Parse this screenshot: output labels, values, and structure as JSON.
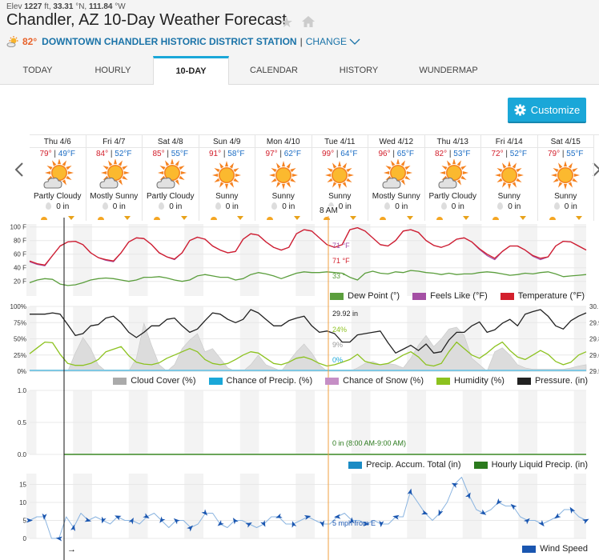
{
  "header": {
    "elev_label": "Elev",
    "elev_value": "1227",
    "elev_unit": "ft,",
    "lat": "33.31",
    "lat_unit": "°N,",
    "lon": "111.84",
    "lon_unit": "°W",
    "title": "Chandler, AZ 10-Day Weather Forecast",
    "current_temp": "82°",
    "station_name": "DOWNTOWN CHANDLER HISTORIC DISTRICT STATION",
    "separator": "|",
    "change_label": "CHANGE"
  },
  "tabs": [
    {
      "label": "TODAY",
      "active": false
    },
    {
      "label": "HOURLY",
      "active": false
    },
    {
      "label": "10-DAY",
      "active": true
    },
    {
      "label": "CALENDAR",
      "active": false
    },
    {
      "label": "HISTORY",
      "active": false
    },
    {
      "label": "WUNDERMAP",
      "active": false
    }
  ],
  "customize_label": "Customize",
  "icons": {
    "prev": "chevron-left-icon",
    "next": "chevron-right-icon",
    "settings": "gear-icon",
    "favorite": "star-icon",
    "home": "home-icon"
  },
  "days": [
    {
      "date": "Thu 4/6",
      "high": "79°",
      "low": "49°F",
      "condition": "Partly Cloudy",
      "icon": "partly-cloudy",
      "precip": "0 in"
    },
    {
      "date": "Fri 4/7",
      "high": "84°",
      "low": "52°F",
      "condition": "Mostly Sunny",
      "icon": "mostly-sunny",
      "precip": "0 in"
    },
    {
      "date": "Sat 4/8",
      "high": "85°",
      "low": "55°F",
      "condition": "Partly Cloudy",
      "icon": "partly-cloudy",
      "precip": "0 in"
    },
    {
      "date": "Sun 4/9",
      "high": "91°",
      "low": "58°F",
      "condition": "Sunny",
      "icon": "sunny",
      "precip": "0 in"
    },
    {
      "date": "Mon 4/10",
      "high": "97°",
      "low": "62°F",
      "condition": "Sunny",
      "icon": "sunny",
      "precip": "0 in"
    },
    {
      "date": "Tue 4/11",
      "high": "99°",
      "low": "64°F",
      "condition": "Sunny",
      "icon": "sunny",
      "precip": "0 in"
    },
    {
      "date": "Wed 4/12",
      "high": "96°",
      "low": "65°F",
      "condition": "Mostly Sunny",
      "icon": "mostly-sunny",
      "precip": "0 in"
    },
    {
      "date": "Thu 4/13",
      "high": "82°",
      "low": "53°F",
      "condition": "Partly Cloudy",
      "icon": "partly-cloudy",
      "precip": "0 in"
    },
    {
      "date": "Fri 4/14",
      "high": "72°",
      "low": "52°F",
      "condition": "Sunny",
      "icon": "sunny",
      "precip": "0 in"
    },
    {
      "date": "Sat 4/15",
      "high": "79°",
      "low": "55°F",
      "condition": "Sunny",
      "icon": "sunny",
      "precip": "0 in"
    }
  ],
  "cursor_time_label": "8 AM",
  "chart_data": [
    {
      "type": "line",
      "title": "Temperature",
      "yticks": [
        "100 F",
        "80 F",
        "60 F",
        "40 F",
        "20 F"
      ],
      "ylim": [
        10,
        105
      ],
      "x_hours": [
        0,
        240
      ],
      "legend": [
        {
          "name": "Dew Point (°)",
          "color": "#5b9e3d"
        },
        {
          "name": "Feels Like (°F)",
          "color": "#a44fa4"
        },
        {
          "name": "Temperature (°F)",
          "color": "#d3202d"
        }
      ],
      "series": [
        {
          "name": "Temperature",
          "color": "#d3202d",
          "values": [
            50,
            46,
            44,
            58,
            72,
            78,
            79,
            74,
            62,
            55,
            52,
            50,
            62,
            78,
            84,
            83,
            74,
            62,
            56,
            53,
            62,
            80,
            85,
            82,
            72,
            66,
            62,
            64,
            82,
            90,
            88,
            78,
            70,
            66,
            70,
            90,
            96,
            94,
            84,
            74,
            70,
            74,
            96,
            99,
            94,
            84,
            74,
            72,
            80,
            94,
            96,
            92,
            80,
            73,
            70,
            74,
            82,
            84,
            78,
            68,
            60,
            54,
            64,
            72,
            72,
            66,
            58,
            54,
            56,
            72,
            79,
            78,
            72,
            66
          ]
        },
        {
          "name": "Feels Like",
          "color": "#a44fa4",
          "values": [
            49,
            45,
            43,
            58,
            72,
            78,
            79,
            74,
            62,
            55,
            51,
            49,
            62,
            78,
            84,
            83,
            74,
            62,
            56,
            52,
            62,
            80,
            85,
            82,
            72,
            66,
            62,
            64,
            82,
            90,
            88,
            78,
            70,
            66,
            70,
            90,
            96,
            94,
            84,
            74,
            70,
            74,
            96,
            99,
            94,
            84,
            74,
            72,
            80,
            94,
            96,
            92,
            80,
            73,
            70,
            74,
            82,
            84,
            78,
            67,
            58,
            52,
            64,
            72,
            72,
            66,
            57,
            52,
            56,
            72,
            79,
            78,
            72,
            66
          ]
        },
        {
          "name": "Dew Point",
          "color": "#5b9e3d",
          "values": [
            18,
            22,
            24,
            23,
            16,
            14,
            15,
            18,
            22,
            24,
            25,
            24,
            22,
            20,
            22,
            26,
            26,
            27,
            25,
            22,
            20,
            22,
            28,
            30,
            28,
            26,
            26,
            22,
            24,
            30,
            33,
            31,
            28,
            24,
            28,
            32,
            34,
            33,
            33,
            34,
            33,
            32,
            26,
            22,
            32,
            35,
            32,
            31,
            34,
            33,
            36,
            35,
            33,
            32,
            30,
            32,
            30,
            31,
            31,
            33,
            34,
            33,
            31,
            29,
            30,
            32,
            31,
            33,
            34,
            31,
            27,
            28,
            29,
            30
          ]
        }
      ],
      "tooltip": {
        "feels_like": "71 °F",
        "temperature": "71 °F",
        "dew_point": "33 °"
      }
    },
    {
      "type": "area",
      "title": "Cloud / Humidity / Pressure",
      "yticks_left": [
        "100%",
        "75%",
        "50%",
        "25%",
        "0%"
      ],
      "yticks_right": [
        "30.",
        "29.9",
        "29.8",
        "29.6",
        "29.5"
      ],
      "ylim": [
        0,
        100
      ],
      "legend": [
        {
          "name": "Cloud Cover (%)",
          "color": "#aaaaaa"
        },
        {
          "name": "Chance of Precip. (%)",
          "color": "#1aa7d8"
        },
        {
          "name": "Chance of Snow (%)",
          "color": "#c58ec5"
        },
        {
          "name": "Humidity (%)",
          "color": "#8cc21f"
        },
        {
          "name": "Pressure. (in)",
          "color": "#222222"
        }
      ],
      "series": [
        {
          "name": "Cloud Cover",
          "color": "#cccccc",
          "values": [
            0,
            0,
            0,
            0,
            0,
            0,
            28,
            52,
            35,
            10,
            0,
            0,
            0,
            0,
            20,
            74,
            40,
            10,
            0,
            10,
            35,
            48,
            58,
            30,
            35,
            20,
            5,
            0,
            0,
            10,
            25,
            10,
            5,
            0,
            15,
            30,
            42,
            28,
            10,
            0,
            0,
            0,
            0,
            5,
            12,
            15,
            10,
            12,
            10,
            5,
            20,
            40,
            55,
            38,
            50,
            65,
            68,
            55,
            20,
            10,
            0,
            30,
            36,
            25,
            10,
            5,
            3,
            3,
            3,
            3,
            3,
            5,
            8,
            10
          ]
        },
        {
          "name": "Chance of Precip.",
          "color": "#7ec8e3",
          "values": [
            0,
            0,
            0,
            0,
            0,
            0,
            0,
            0,
            0,
            0,
            0,
            0,
            0,
            0,
            0,
            0,
            0,
            0,
            0,
            0,
            0,
            0,
            0,
            0,
            0,
            0,
            0,
            0,
            0,
            0,
            0,
            0,
            0,
            0,
            0,
            0,
            0,
            0,
            0,
            0,
            0,
            0,
            0,
            0,
            0,
            0,
            0,
            0,
            0,
            0,
            0,
            0,
            0,
            0,
            0,
            0,
            0,
            0,
            0,
            0,
            0,
            0,
            0,
            0,
            0,
            0,
            0,
            0,
            0,
            0,
            0,
            0,
            0,
            0
          ]
        },
        {
          "name": "Humidity",
          "color": "#8cc21f",
          "values": [
            27,
            36,
            45,
            44,
            26,
            12,
            9,
            9,
            12,
            18,
            30,
            34,
            38,
            24,
            14,
            11,
            10,
            13,
            20,
            25,
            30,
            35,
            30,
            18,
            12,
            10,
            12,
            18,
            25,
            30,
            28,
            20,
            12,
            10,
            14,
            20,
            22,
            18,
            12,
            8,
            10,
            14,
            18,
            26,
            15,
            12,
            10,
            12,
            18,
            25,
            30,
            22,
            10,
            8,
            12,
            30,
            45,
            35,
            25,
            20,
            28,
            38,
            45,
            32,
            22,
            18,
            25,
            32,
            26,
            15,
            10,
            14,
            25,
            30
          ]
        },
        {
          "name": "Pressure",
          "color": "#222222",
          "values": [
            88,
            88,
            88,
            90,
            88,
            72,
            55,
            58,
            70,
            72,
            82,
            85,
            75,
            60,
            52,
            60,
            70,
            70,
            80,
            82,
            70,
            60,
            65,
            78,
            90,
            88,
            80,
            75,
            80,
            95,
            90,
            80,
            70,
            70,
            78,
            82,
            85,
            70,
            60,
            62,
            58,
            45,
            45,
            56,
            58,
            60,
            62,
            44,
            28,
            34,
            40,
            32,
            42,
            28,
            30,
            48,
            60,
            60,
            70,
            76,
            60,
            64,
            74,
            80,
            70,
            88,
            92,
            95,
            85,
            70,
            65,
            78,
            85,
            90
          ]
        }
      ],
      "tooltip": {
        "pressure": "29.92 in",
        "humidity": "24%",
        "cloud_cover": "9%",
        "precip_chance": "0%"
      }
    },
    {
      "type": "line",
      "title": "Precipitation",
      "yticks": [
        "1.0",
        "0.5",
        "0.0"
      ],
      "ylim": [
        0,
        1
      ],
      "legend": [
        {
          "name": "Precip. Accum. Total (in)",
          "color": "#1a8bc4"
        },
        {
          "name": "Hourly Liquid Precip. (in)",
          "color": "#2b7a1d"
        }
      ],
      "series": [
        {
          "name": "Hourly Liquid Precip.",
          "color": "#6ba55a",
          "values": [
            0,
            0,
            0,
            0,
            0,
            0,
            0,
            0,
            0,
            0,
            0,
            0,
            0,
            0,
            0,
            0,
            0,
            0,
            0,
            0,
            0,
            0,
            0,
            0,
            0,
            0,
            0,
            0,
            0,
            0,
            0,
            0,
            0,
            0,
            0,
            0,
            0,
            0,
            0,
            0,
            0,
            0,
            0,
            0,
            0,
            0,
            0,
            0,
            0,
            0,
            0,
            0,
            0,
            0,
            0,
            0,
            0,
            0,
            0,
            0,
            0,
            0,
            0,
            0,
            0,
            0,
            0,
            0,
            0,
            0,
            0,
            0,
            0,
            0
          ]
        }
      ],
      "tooltip": {
        "precip": "0 in (8:00 AM-9:00 AM)"
      }
    },
    {
      "type": "line",
      "title": "Wind Speed",
      "yticks": [
        "15",
        "10",
        "5",
        "0"
      ],
      "ylim": [
        0,
        18
      ],
      "legend": [
        {
          "name": "Wind Speed",
          "color": "#1a56b0"
        }
      ],
      "series": [
        {
          "name": "Wind Speed",
          "color": "#8ab4e0",
          "values": [
            5,
            6,
            6,
            0,
            0,
            6,
            3,
            7,
            5,
            6,
            5,
            4,
            6,
            5,
            5,
            4,
            6,
            7,
            5,
            3,
            5,
            5,
            3,
            4,
            7,
            7,
            4,
            3,
            5,
            5,
            4,
            3,
            4,
            6,
            6,
            4,
            4,
            5,
            6,
            5,
            4,
            4,
            6,
            7,
            5,
            5,
            4,
            5,
            4,
            4,
            6,
            6,
            13,
            10,
            7,
            5,
            7,
            10,
            15,
            17,
            12,
            8,
            7,
            8,
            10,
            9,
            9,
            6,
            5,
            5,
            4,
            5,
            6,
            8,
            8,
            6,
            5
          ]
        }
      ],
      "tooltip": {
        "wind": "5 mph from E"
      }
    }
  ]
}
